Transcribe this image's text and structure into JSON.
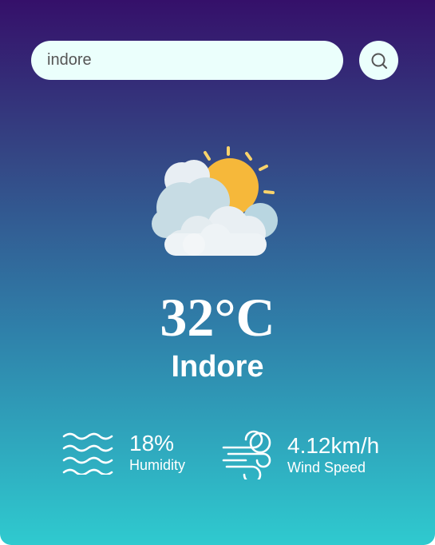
{
  "search": {
    "value": "indore",
    "icon": "search-icon"
  },
  "weather": {
    "icon": "sun-behind-clouds-icon",
    "temperature": "32°C",
    "city": "Indore"
  },
  "humidity": {
    "value": "18%",
    "label": "Humidity",
    "icon": "humidity-waves-icon"
  },
  "wind": {
    "value": "4.12km/h",
    "label": "Wind Speed",
    "icon": "wind-icon"
  },
  "colors": {
    "gradient_top": "#35106a",
    "gradient_bottom": "#2fcacf",
    "input_bg": "#ebfffc",
    "text": "#ffffff"
  }
}
